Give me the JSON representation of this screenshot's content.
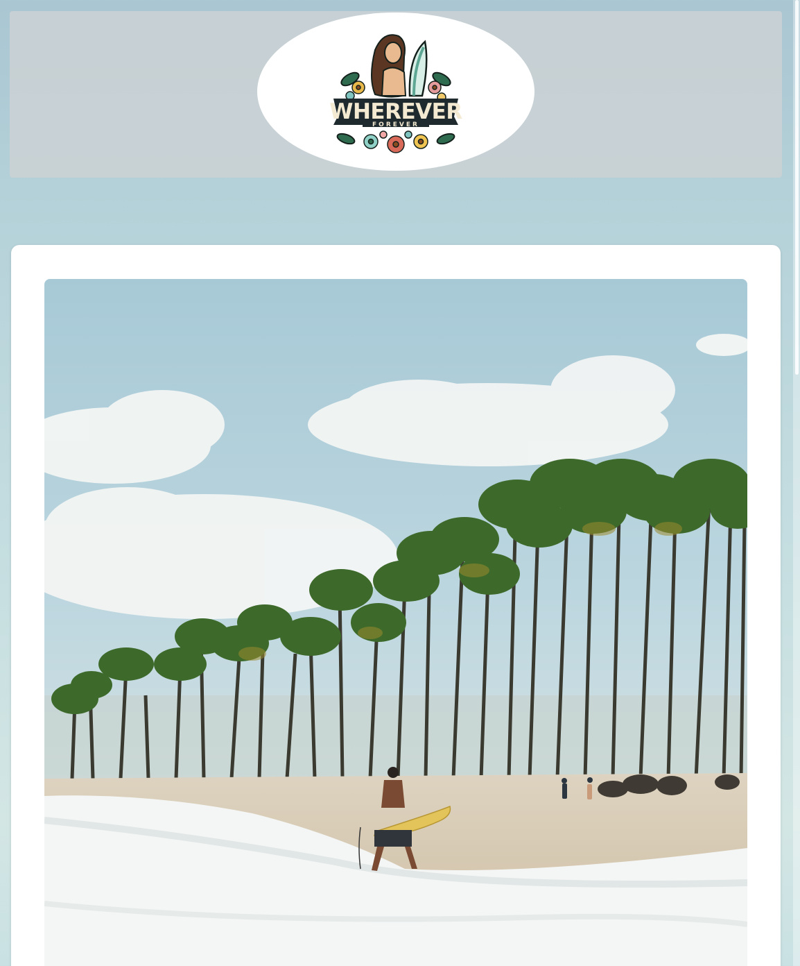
{
  "header": {
    "logo": {
      "brand": "WHEREVER",
      "tagline": "FOREVER",
      "icon": "surfer-girl-logo-icon"
    }
  },
  "main": {
    "hero_image": {
      "icon": "beach-surfer-photo"
    }
  },
  "colors": {
    "page_background": "#b7d3da",
    "header_background": "#cdd2d4",
    "card_background": "#ffffff",
    "logo_dark": "#1f2a2e",
    "logo_cream": "#f4ead2"
  }
}
